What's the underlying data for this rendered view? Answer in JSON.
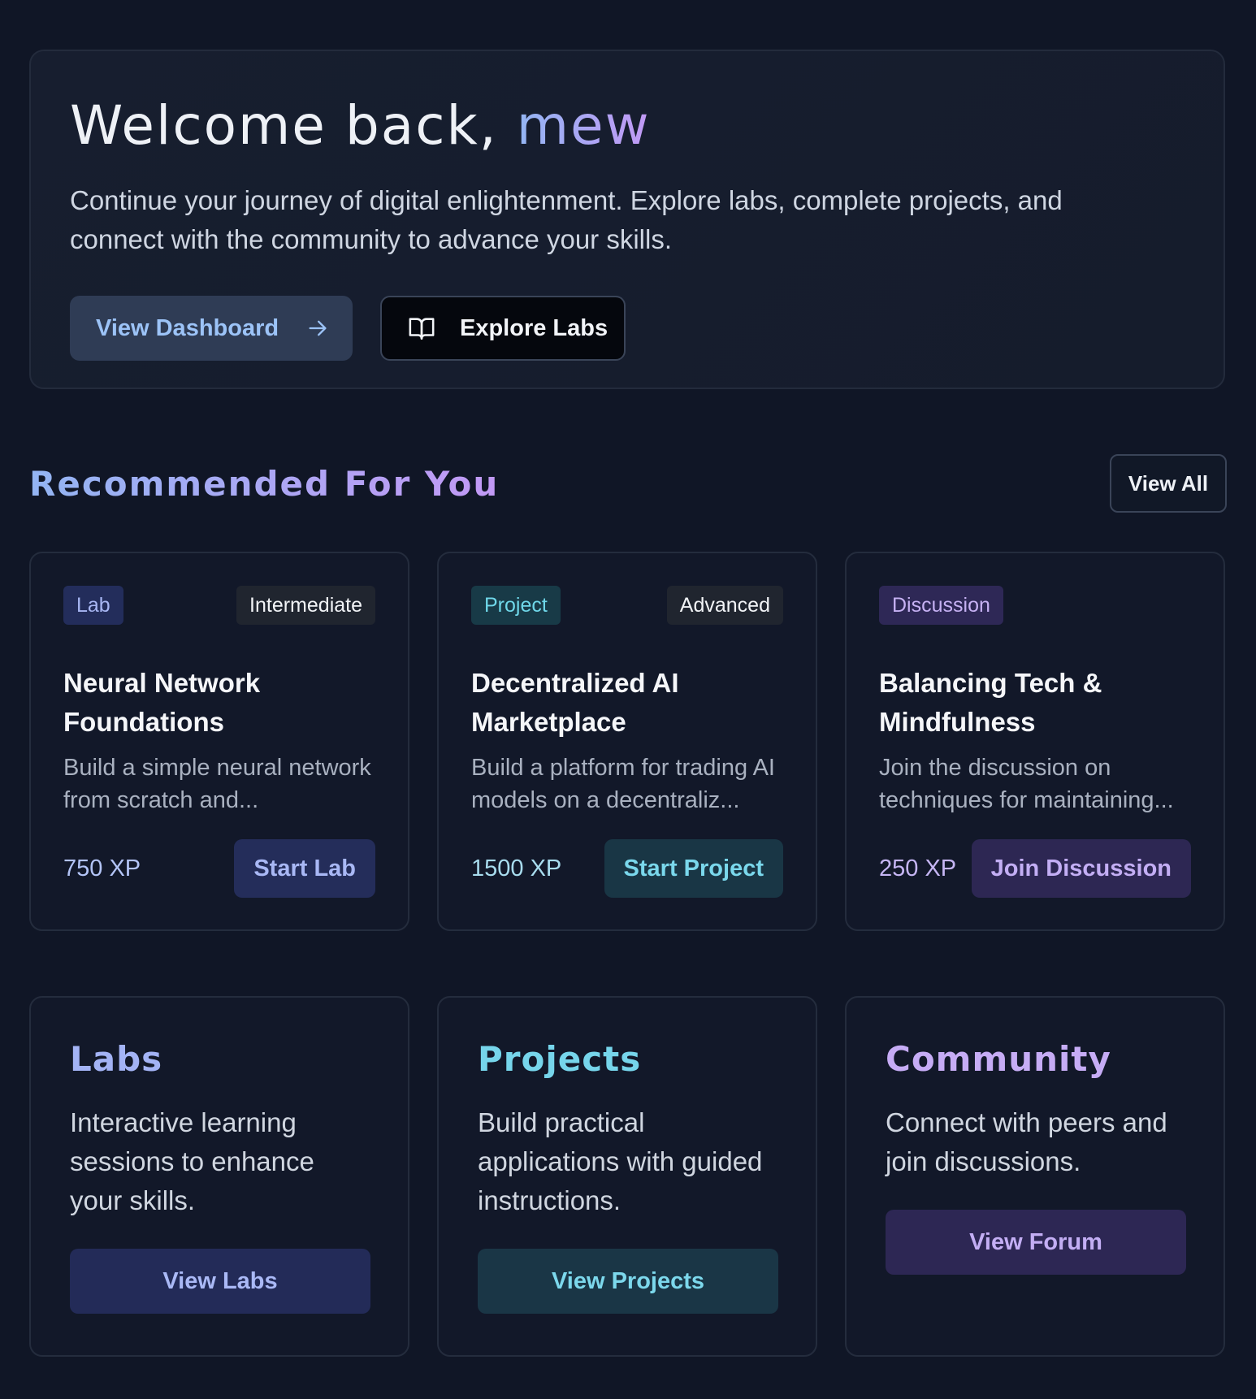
{
  "hero": {
    "greeting": "Welcome back,",
    "username": "mew",
    "subtitle": "Continue your journey of digital enlightenment. Explore labs, complete projects, and connect with the community to advance your skills.",
    "dashboard_button": "View Dashboard",
    "explore_button": "Explore Labs"
  },
  "recommended": {
    "title": "Recommended For You",
    "view_all": "View All",
    "cards": [
      {
        "type": "Lab",
        "level": "Intermediate",
        "title": "Neural Network Foundations",
        "description": "Build a simple neural network from scratch and...",
        "xp": "750 XP",
        "action": "Start Lab"
      },
      {
        "type": "Project",
        "level": "Advanced",
        "title": "Decentralized AI Marketplace",
        "description": "Build a platform for trading AI models on a decentraliz...",
        "xp": "1500 XP",
        "action": "Start Project"
      },
      {
        "type": "Discussion",
        "level": "",
        "title": "Balancing Tech & Mindfulness",
        "description": "Join the discussion on techniques for maintaining...",
        "xp": "250 XP",
        "action": "Join Discussion"
      }
    ]
  },
  "features": [
    {
      "title": "Labs",
      "description": "Interactive learning sessions to enhance your skills.",
      "action": "View Labs"
    },
    {
      "title": "Projects",
      "description": "Build practical applications with guided instructions.",
      "action": "View Projects"
    },
    {
      "title": "Community",
      "description": "Connect with peers and join discussions.",
      "action": "View Forum"
    }
  ],
  "icons": {
    "dashboard_arrow": "arrow-right-icon",
    "explore_book": "book-open-icon"
  },
  "colors": {
    "background": "#101626",
    "accent_gradient_start": "#93b5f3",
    "accent_gradient_end": "#c299f5",
    "lab_accent": "#a7b6f3",
    "project_accent": "#6fd7e9",
    "discussion_accent": "#c6b1f3"
  }
}
